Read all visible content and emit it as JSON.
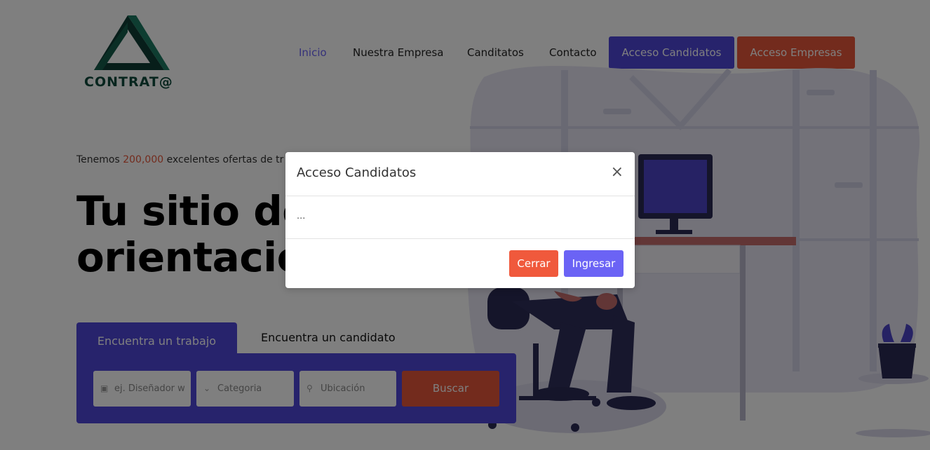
{
  "brand": {
    "logo_text": "CONTRAT@"
  },
  "nav": {
    "links": [
      "Inicio",
      "Nuestra Empresa",
      "Canditatos",
      "Contacto"
    ],
    "candidates_button": "Acceso Candidatos",
    "companies_button": "Acceso Empresas"
  },
  "hero": {
    "tagline_prefix": "Tenemos ",
    "tagline_number": "200,000",
    "tagline_suffix": " excelentes ofertas de tr",
    "title_line1": "Tu sitio de",
    "title_line2": "orientación"
  },
  "search": {
    "tab_active": "Encuentra un trabajo",
    "tab_inactive": "Encuentra un candidato",
    "keyword_placeholder": "ej. Diseñador w",
    "category_placeholder": "Categoria",
    "location_placeholder": "Ubicación",
    "button": "Buscar"
  },
  "modal": {
    "title": "Acceso Candidatos",
    "close_symbol": "×",
    "body": "...",
    "close_button": "Cerrar",
    "submit_button": "Ingresar"
  },
  "colors": {
    "primary": "#4f46d8",
    "accent": "#e7563a",
    "modal_submit": "#6b63f5"
  }
}
